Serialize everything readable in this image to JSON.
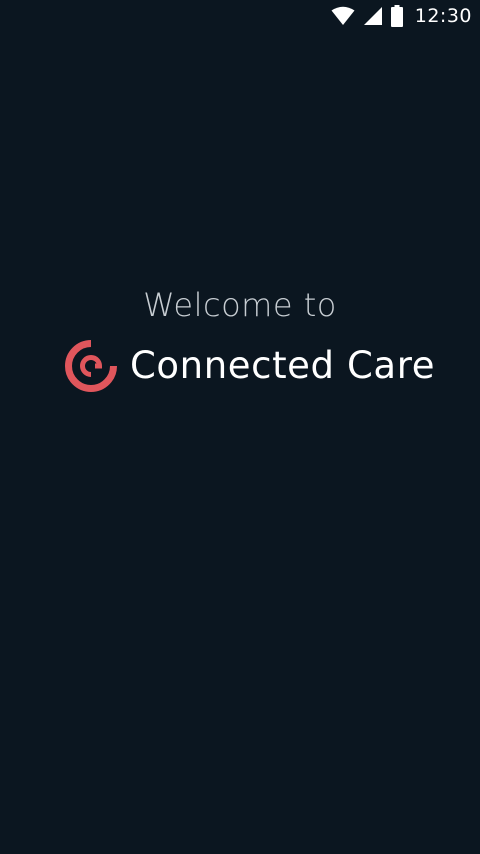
{
  "status_bar": {
    "time": "12:30",
    "icons": [
      "wifi-icon",
      "cellular-signal-icon",
      "battery-icon"
    ]
  },
  "splash": {
    "welcome": "Welcome to",
    "brand_name": "Connected Care",
    "logo_icon": "connected-care-logo-icon"
  },
  "colors": {
    "background": "#0b1620",
    "brand_accent": "#e0565c",
    "text": "#ffffff"
  }
}
